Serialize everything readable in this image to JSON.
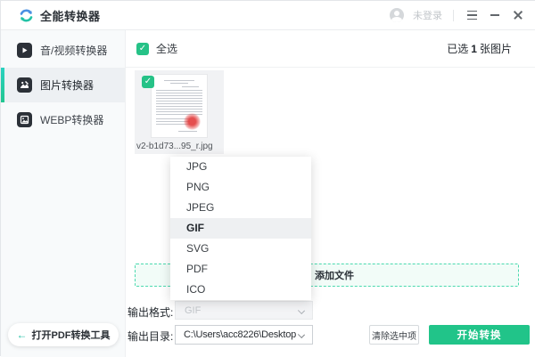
{
  "titlebar": {
    "app_title": "全能转换器",
    "login_status": "未登录"
  },
  "sidebar": {
    "items": [
      {
        "label": "音/视频转换器",
        "icon": "audio-video-icon",
        "active": false
      },
      {
        "label": "图片转换器",
        "icon": "image-icon",
        "active": true
      },
      {
        "label": "WEBP转换器",
        "icon": "webp-icon",
        "active": false
      }
    ],
    "footer_link": "打开PDF转换工具"
  },
  "toolbar": {
    "select_all_label": "全选",
    "selected_prefix": "已选",
    "selected_count": "1",
    "selected_suffix": "张图片"
  },
  "files": [
    {
      "name": "v2-b1d73...95_r.jpg",
      "selected": true
    }
  ],
  "format_dropdown": {
    "options": [
      "JPG",
      "PNG",
      "JPEG",
      "GIF",
      "SVG",
      "PDF",
      "ICO"
    ],
    "highlighted": "GIF"
  },
  "add_file": {
    "label": "添加文件"
  },
  "output": {
    "format_label": "输出格式:",
    "format_value": "GIF",
    "dir_label": "输出目录:",
    "dir_value": "C:\\Users\\acc8226\\Desktop"
  },
  "actions": {
    "clear_label": "清除选中项",
    "start_label": "开始转换"
  },
  "colors": {
    "primary_green": "#21c489",
    "teal_accent": "#2ad1c0",
    "dashed_border": "#4ad9ae",
    "stamp_red": "#e23b3b"
  }
}
